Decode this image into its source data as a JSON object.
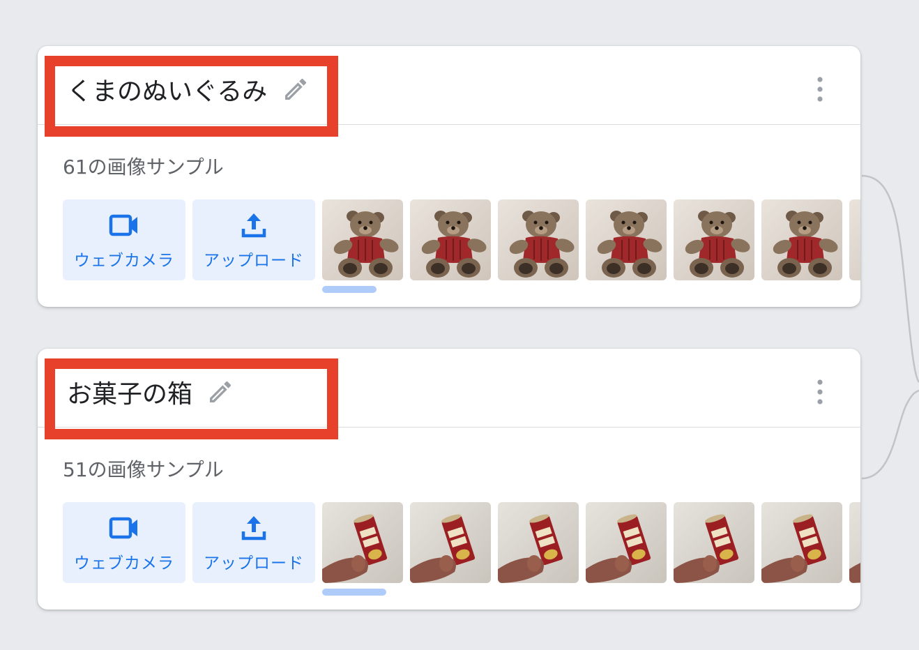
{
  "classes": [
    {
      "title": "くまのぬいぐるみ",
      "sample_count": "61の画像サンプル",
      "webcam_label": "ウェブカメラ",
      "upload_label": "アップロード",
      "thumbnails": [
        "teddy-bear",
        "teddy-bear",
        "teddy-bear",
        "teddy-bear",
        "teddy-bear",
        "teddy-bear",
        "teddy-bear"
      ]
    },
    {
      "title": "お菓子の箱",
      "sample_count": "51の画像サンプル",
      "webcam_label": "ウェブカメラ",
      "upload_label": "アップロード",
      "thumbnails": [
        "snack-can",
        "snack-can",
        "snack-can",
        "snack-can",
        "snack-can",
        "snack-can",
        "snack-can"
      ]
    }
  ],
  "scroll_progress": [
    0.07,
    0.08
  ],
  "colors": {
    "background": "#e8eaed",
    "card": "#ffffff",
    "accent": "#1a73e8",
    "button_bg": "#e8f0fe",
    "highlight": "#e8412b",
    "icon_gray": "#9aa0a6"
  },
  "icons": {
    "edit": "pencil-icon",
    "more": "more-vert-icon",
    "webcam": "video-camera-icon",
    "upload": "upload-icon"
  }
}
